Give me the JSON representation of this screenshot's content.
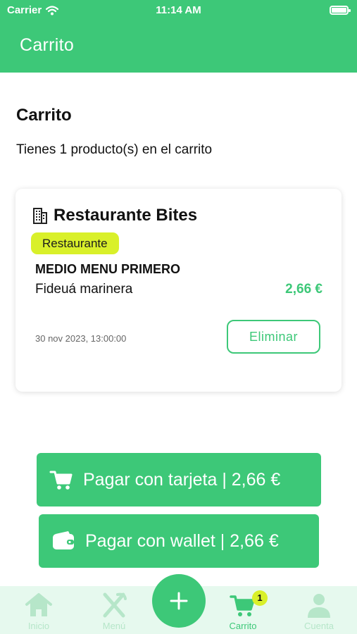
{
  "status_bar": {
    "carrier": "Carrier",
    "time": "11:14 AM"
  },
  "header": {
    "title": "Carrito"
  },
  "page": {
    "title": "Carrito",
    "subtitle": "Tienes 1 producto(s) en el carrito"
  },
  "cart_item": {
    "restaurant": "Restaurante Bites",
    "type_badge": "Restaurante",
    "menu": "MEDIO MENU PRIMERO",
    "dish": "Fideuá marinera",
    "price": "2,66 €",
    "datetime": "30 nov 2023, 13:00:00",
    "delete_label": "Eliminar"
  },
  "payment": {
    "card_label": "Pagar con tarjeta | 2,66 €",
    "wallet_label": "Pagar con wallet | 2,66 €"
  },
  "tabbar": {
    "items": [
      {
        "label": "Inicio",
        "icon": "home-icon"
      },
      {
        "label": "Menú",
        "icon": "cutlery-icon"
      },
      {
        "label": "",
        "icon": "plus-icon"
      },
      {
        "label": "Carrito",
        "icon": "cart-icon",
        "badge": "1",
        "active": true
      },
      {
        "label": "Cuenta",
        "icon": "user-icon"
      }
    ]
  },
  "colors": {
    "primary": "#3dc878",
    "accent": "#d9f02a",
    "tabbar_bg": "#e6f9ee"
  }
}
